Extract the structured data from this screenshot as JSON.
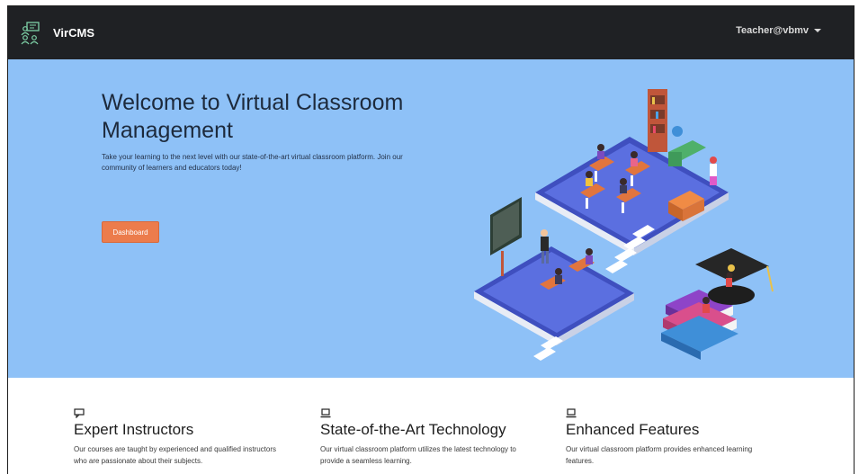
{
  "navbar": {
    "brand": "VirCMS",
    "user": "Teacher@vbmv"
  },
  "hero": {
    "title": "Welcome to Virtual Classroom Management",
    "subtitle": "Take your learning to the next level with our state-of-the-art virtual classroom platform. Join our community of learners and educators today!",
    "button": "Dashboard"
  },
  "features": [
    {
      "icon": "chat-icon",
      "title": "Expert Instructors",
      "text": "Our courses are taught by experienced and qualified instructors who are passionate about their subjects."
    },
    {
      "icon": "laptop-icon",
      "title": "State-of-the-Art Technology",
      "text": "Our virtual classroom platform utilizes the latest technology to provide a seamless learning."
    },
    {
      "icon": "laptop-icon",
      "title": "Enhanced Features",
      "text": "Our virtual classroom platform provides enhanced learning features."
    }
  ],
  "colors": {
    "navbar": "#1f2124",
    "hero_bg": "#8ec1f7",
    "accent": "#ec7c4c"
  }
}
